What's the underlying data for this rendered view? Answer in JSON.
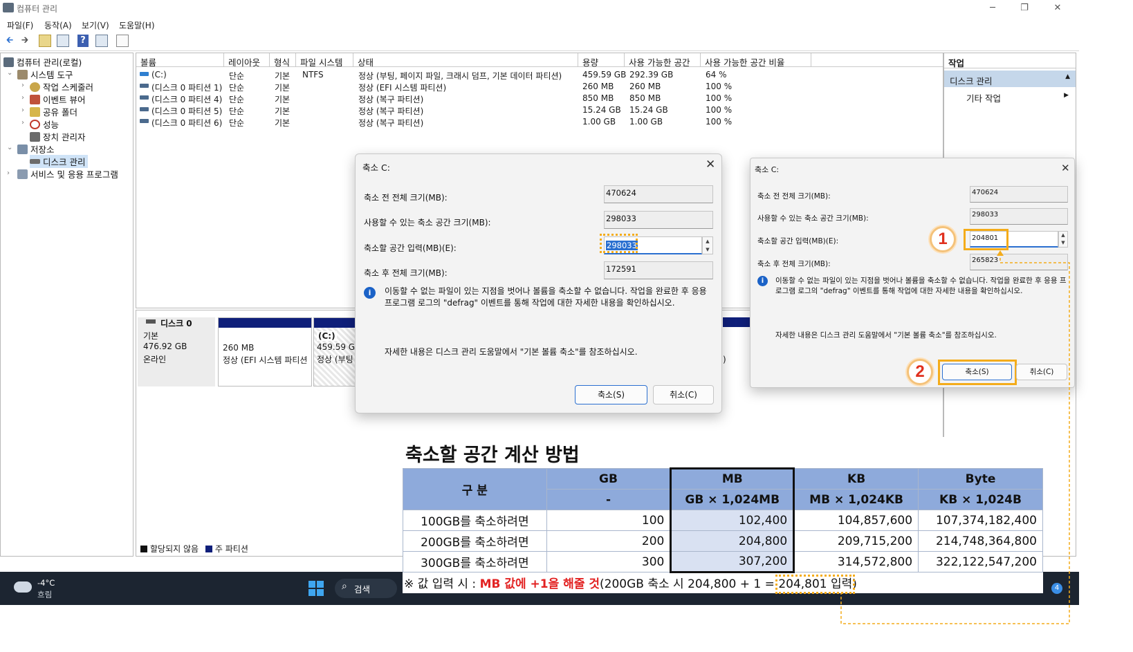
{
  "window": {
    "title": "컴퓨터 관리",
    "menu": [
      "파일(F)",
      "동작(A)",
      "보기(V)",
      "도움말(H)"
    ],
    "min_icon": "─",
    "restore_icon": "❐",
    "close_icon": "✕"
  },
  "tree": {
    "root": "컴퓨터 관리(로컬)",
    "system_tools": "시스템 도구",
    "task_scheduler": "작업 스케줄러",
    "event_viewer": "이벤트 뷰어",
    "shared_folders": "공유 폴더",
    "performance": "성능",
    "device_manager": "장치 관리자",
    "storage": "저장소",
    "disk_management": "디스크 관리",
    "services": "서비스 및 응용 프로그램"
  },
  "volumes": {
    "headers": [
      "볼륨",
      "레이아웃",
      "형식",
      "파일 시스템",
      "상태",
      "용량",
      "사용 가능한 공간",
      "사용 가능한 공간 비율"
    ],
    "rows": [
      {
        "volume": "(C:)",
        "layout": "단순",
        "type": "기본",
        "fs": "NTFS",
        "status": "정상 (부팅, 페이지 파일, 크래시 덤프, 기본 데이터 파티션)",
        "capacity": "459.59 GB",
        "free": "292.39 GB",
        "pct": "64 %"
      },
      {
        "volume": "(디스크 0 파티션 1)",
        "layout": "단순",
        "type": "기본",
        "fs": "",
        "status": "정상 (EFI 시스템 파티션)",
        "capacity": "260 MB",
        "free": "260 MB",
        "pct": "100 %"
      },
      {
        "volume": "(디스크 0 파티션 4)",
        "layout": "단순",
        "type": "기본",
        "fs": "",
        "status": "정상 (복구 파티션)",
        "capacity": "850 MB",
        "free": "850 MB",
        "pct": "100 %"
      },
      {
        "volume": "(디스크 0 파티션 5)",
        "layout": "단순",
        "type": "기본",
        "fs": "",
        "status": "정상 (복구 파티션)",
        "capacity": "15.24 GB",
        "free": "15.24 GB",
        "pct": "100 %"
      },
      {
        "volume": "(디스크 0 파티션 6)",
        "layout": "단순",
        "type": "기본",
        "fs": "",
        "status": "정상 (복구 파티션)",
        "capacity": "1.00 GB",
        "free": "1.00 GB",
        "pct": "100 %"
      }
    ]
  },
  "disk": {
    "name": "디스크 0",
    "kind": "기본",
    "size": "476.92 GB",
    "state": "온라인",
    "p1_size": "260 MB",
    "p1_status": "정상 (EFI 시스템 파티션",
    "p2_name": "(C:)",
    "p2_size": "459.59 GB",
    "p2_status": "정상 (부팅",
    "right_fragment": ")",
    "legend_unalloc": "할당되지 않음",
    "legend_primary": "주 파티션"
  },
  "actions": {
    "header": "작업",
    "disk_management": "디스크 관리",
    "other": "기타 작업"
  },
  "dialog1": {
    "title": "축소 C:",
    "close": "✕",
    "total_before_label": "축소 전 전체 크기(MB):",
    "total_before": "470624",
    "available_label": "사용할 수 있는 축소 공간 크기(MB):",
    "available": "298033",
    "input_label": "축소할 공간 입력(MB)(E):",
    "input": "298033",
    "total_after_label": "축소 후 전체 크기(MB):",
    "total_after": "172591",
    "info": "이동할 수 없는 파일이 있는 지점을 벗어나 볼륨을 축소할 수 없습니다. 작업을 완료한 후 응용 프로그램 로그의 \"defrag\" 이벤트를 통해 작업에 대한 자세한 내용을 확인하십시오.",
    "help": "자세한 내용은 디스크 관리 도움말에서 \"기본 볼륨 축소\"를 참조하십시오.",
    "shrink_btn": "축소(S)",
    "cancel_btn": "취소(C)"
  },
  "dialog2": {
    "title": "축소 C:",
    "close": "✕",
    "total_before_label": "축소 전 전체 크기(MB):",
    "total_before": "470624",
    "available_label": "사용할 수 있는 축소 공간 크기(MB):",
    "available": "298033",
    "input_label": "축소할 공간 입력(MB)(E):",
    "input": "204801",
    "total_after_label": "축소 후 전체 크기(MB):",
    "total_after": "265823",
    "info": "이동할 수 없는 파일이 있는 지점을 벗어나 볼륨을 축소할 수 없습니다. 작업을 완료한 후 응용 프로그램 로그의 \"defrag\" 이벤트를 통해 작업에 대한 자세한 내용을 확인하십시오.",
    "help": "자세한 내용은 디스크 관리 도움말에서 \"기본 볼륨 축소\"를 참조하십시오.",
    "shrink_btn": "축소(S)",
    "cancel_btn": "취소(C)",
    "step1": "1",
    "step2": "2"
  },
  "calc": {
    "title": "축소할 공간 계산 방법",
    "head_label": "구 분",
    "cols": [
      "GB",
      "MB",
      "KB",
      "Byte"
    ],
    "formulas": [
      "-",
      "GB × 1,024MB",
      "MB × 1,024KB",
      "KB × 1,024B"
    ],
    "rows": [
      {
        "label": "100GB를 축소하려면",
        "gb": "100",
        "mb": "102,400",
        "kb": "104,857,600",
        "byte": "107,374,182,400"
      },
      {
        "label": "200GB를 축소하려면",
        "gb": "200",
        "mb": "204,800",
        "kb": "209,715,200",
        "byte": "214,748,364,800"
      },
      {
        "label": "300GB를 축소하려면",
        "gb": "300",
        "mb": "307,200",
        "kb": "314,572,800",
        "byte": "322,122,547,200"
      }
    ],
    "note_prefix": "※ 값 입력 시 : ",
    "note_red": "MB 값에 +1을 해줄 것",
    "note_mid": "(200GB 축소 시 204,800 + 1 = ",
    "note_result": "204,801 입력",
    "note_end": ")"
  },
  "taskbar": {
    "temp": "-4°C",
    "weather": "흐림",
    "search": "검색",
    "badge": "4"
  },
  "colors": {
    "highlight": "#f4ac1a",
    "primary_partition": "#0f1f7a",
    "table_header": "#8eaadb",
    "table_mb": "#d9e1f2",
    "note_red": "#e22222"
  }
}
